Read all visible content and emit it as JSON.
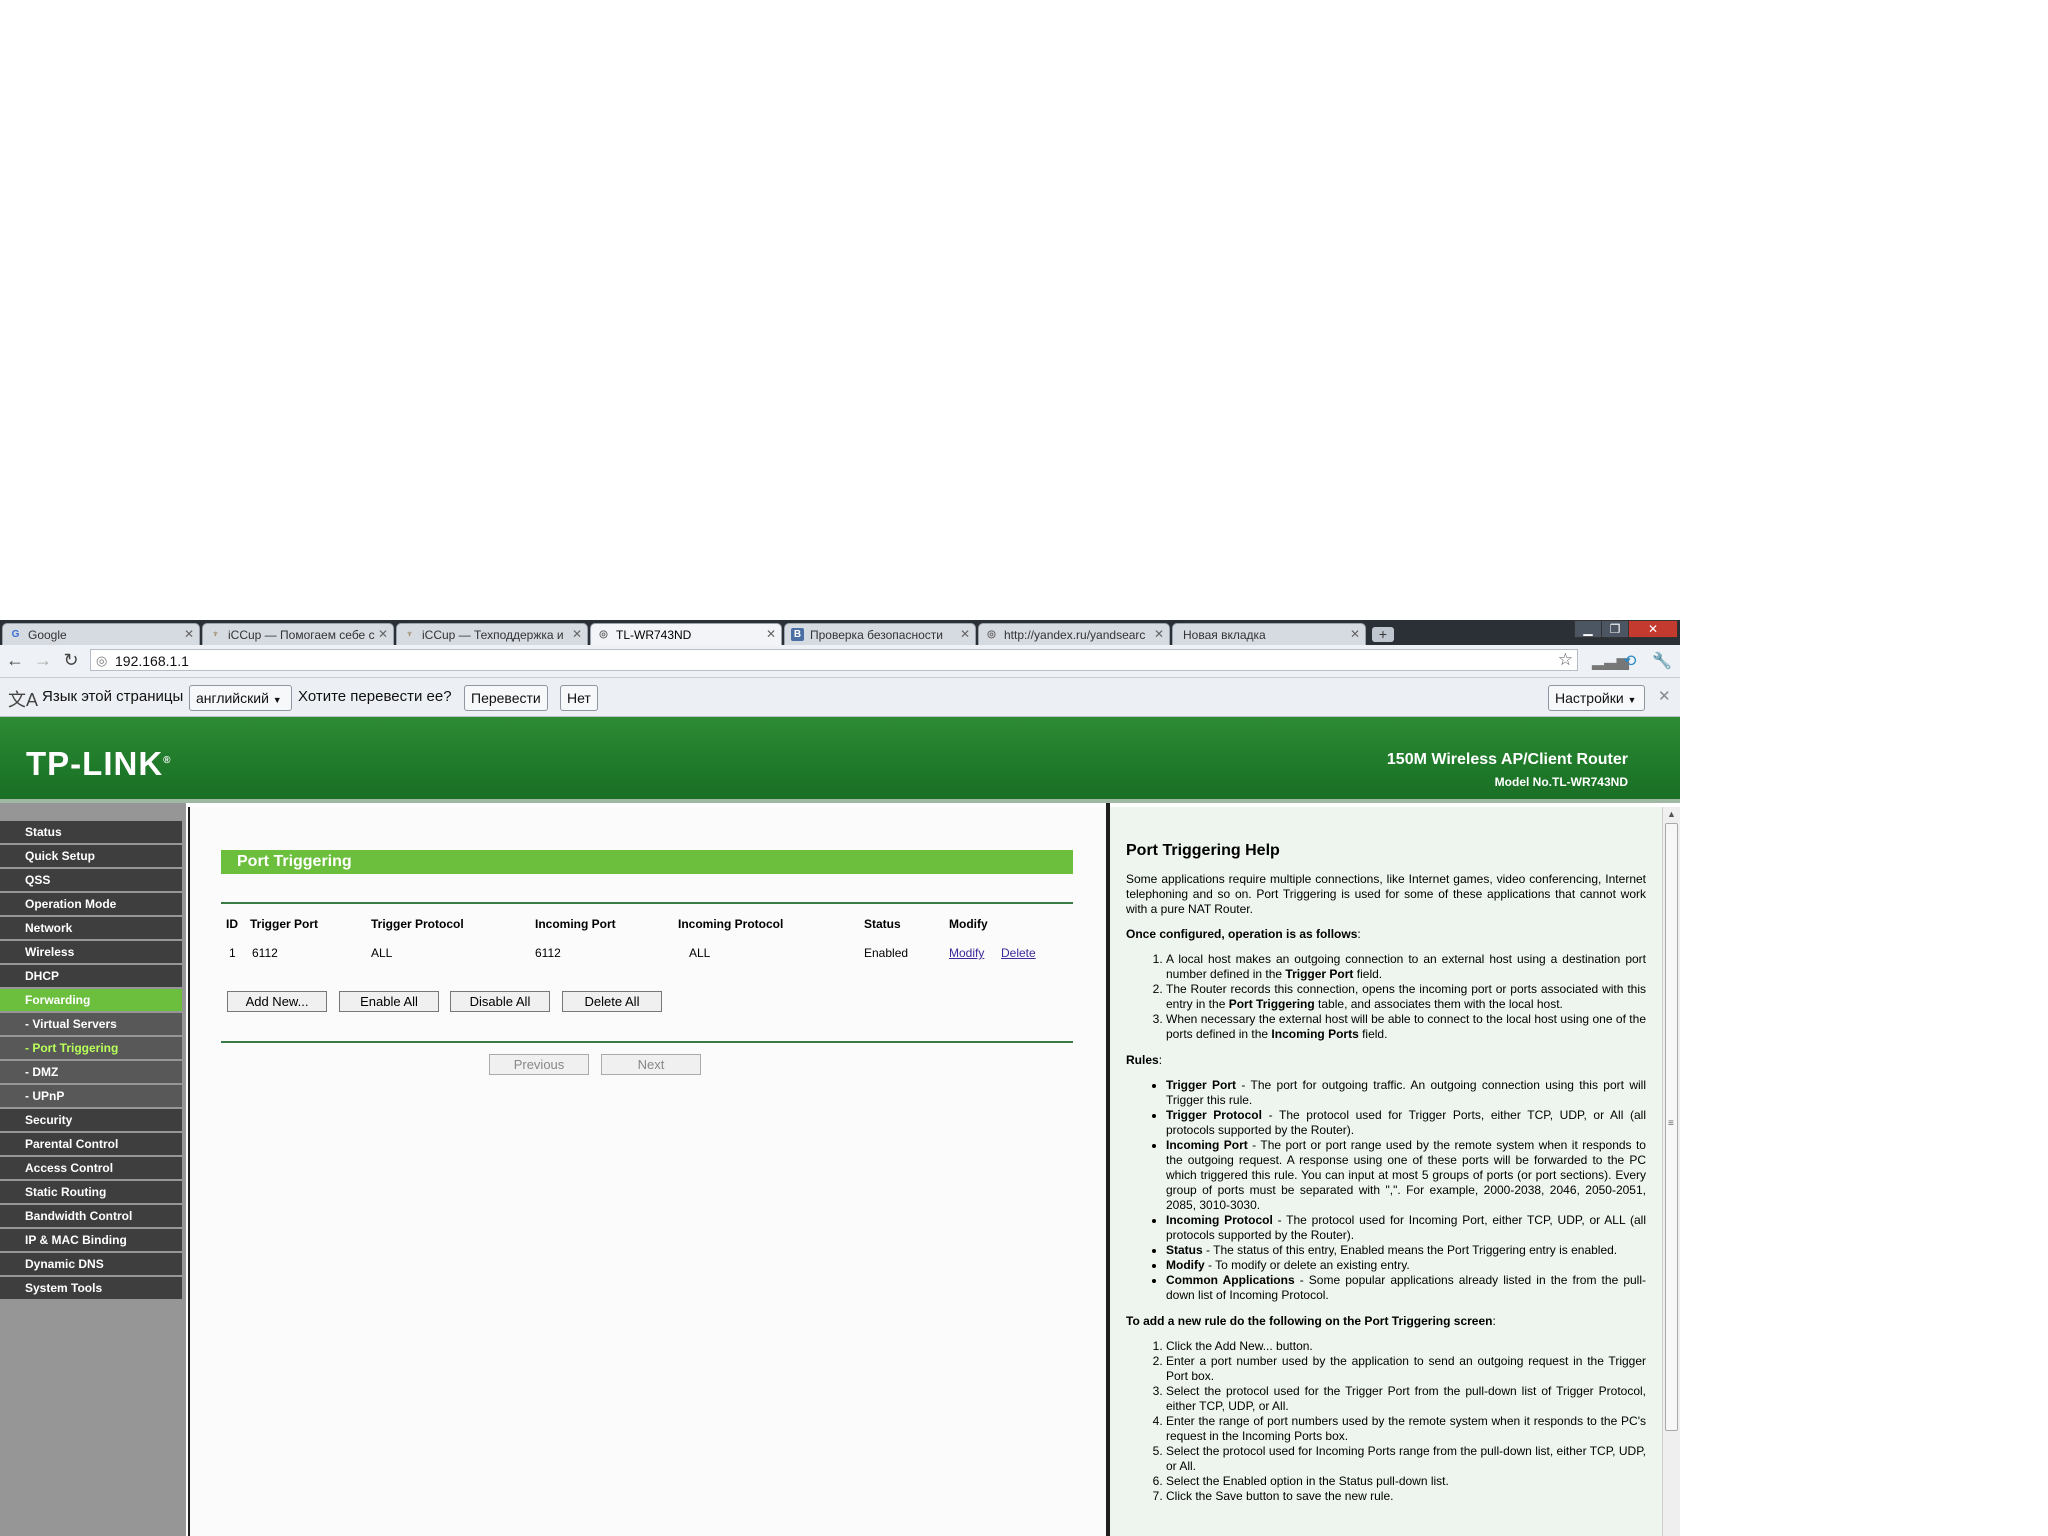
{
  "browser": {
    "tabs": [
      {
        "label": "Google",
        "favicon": "google-icon"
      },
      {
        "label": "iCCup — Помогаем себе с",
        "favicon": "iccup-icon"
      },
      {
        "label": "iCCup — Техподдержка и",
        "favicon": "iccup-icon"
      },
      {
        "label": "TL-WR743ND",
        "favicon": "globe-icon",
        "active": true
      },
      {
        "label": "Проверка безопасности",
        "favicon": "vk-icon"
      },
      {
        "label": "http://yandex.ru/yandsearc",
        "favicon": "globe-icon"
      },
      {
        "label": "Новая вкладка",
        "favicon": ""
      }
    ],
    "url": "192.168.1.1",
    "new_tab_symbol": "+"
  },
  "translate_bar": {
    "prefix": "Язык этой страницы",
    "language": "английский",
    "question": "Хотите перевести ее?",
    "translate_button": "Перевести",
    "no_button": "Нет",
    "settings_button": "Настройки"
  },
  "router": {
    "logo": "TP-LINK",
    "logo_mark": "®",
    "product": "150M Wireless AP/Client Router",
    "model": "Model No.TL-WR743ND"
  },
  "menu": [
    {
      "label": "Status",
      "type": "item"
    },
    {
      "label": "Quick Setup",
      "type": "item"
    },
    {
      "label": "QSS",
      "type": "item"
    },
    {
      "label": "Operation Mode",
      "type": "item"
    },
    {
      "label": "Network",
      "type": "item"
    },
    {
      "label": "Wireless",
      "type": "item"
    },
    {
      "label": "DHCP",
      "type": "item"
    },
    {
      "label": "Forwarding",
      "type": "active"
    },
    {
      "label": "- Virtual Servers",
      "type": "sub"
    },
    {
      "label": "- Port Triggering",
      "type": "subactive"
    },
    {
      "label": "- DMZ",
      "type": "sub"
    },
    {
      "label": "- UPnP",
      "type": "sub"
    },
    {
      "label": "Security",
      "type": "item"
    },
    {
      "label": "Parental Control",
      "type": "item"
    },
    {
      "label": "Access Control",
      "type": "item"
    },
    {
      "label": "Static Routing",
      "type": "item"
    },
    {
      "label": "Bandwidth Control",
      "type": "item"
    },
    {
      "label": "IP & MAC Binding",
      "type": "item"
    },
    {
      "label": "Dynamic DNS",
      "type": "item"
    },
    {
      "label": "System Tools",
      "type": "item"
    }
  ],
  "main": {
    "title": "Port Triggering",
    "columns": [
      "ID",
      "Trigger Port",
      "Trigger Protocol",
      "Incoming Port",
      "Incoming Protocol",
      "Status",
      "Modify"
    ],
    "row": {
      "id": "1",
      "trigger_port": "6112",
      "trigger_protocol": "ALL",
      "incoming_port": "6112",
      "incoming_protocol": "ALL",
      "status": "Enabled",
      "modify_link": "Modify",
      "delete_link": "Delete"
    },
    "buttons": {
      "add_new": "Add New...",
      "enable_all": "Enable All",
      "disable_all": "Disable All",
      "delete_all": "Delete All",
      "previous": "Previous",
      "next": "Next"
    }
  },
  "help": {
    "title": "Port Triggering Help",
    "intro": "Some applications require multiple connections, like Internet games, video conferencing, Internet telephoning and so on. Port Triggering is used for some of these applications that cannot work with a pure NAT Router.",
    "once_configured": "Once configured, operation is as follows",
    "operation_steps": [
      {
        "pre": "A local host makes an outgoing connection to an external host using a destination port number defined in the ",
        "bold": "Trigger Port",
        "post": " field."
      },
      {
        "pre": "The Router records this connection, opens the incoming port or ports associated with this entry in the ",
        "bold": "Port Triggering",
        "post": " table, and associates them with the local host."
      },
      {
        "pre": "When necessary the external host will be able to connect to the local host using one of the ports defined in the ",
        "bold": "Incoming Ports",
        "post": " field."
      }
    ],
    "rules_label": "Rules",
    "rules": [
      {
        "bold": "Trigger Port",
        "text": " - The port for outgoing traffic. An outgoing connection using this port will Trigger this rule."
      },
      {
        "bold": "Trigger Protocol",
        "text": " - The protocol used for Trigger Ports, either TCP, UDP, or All (all protocols supported by the Router)."
      },
      {
        "bold": "Incoming Port",
        "text": " - The port or port range used by the remote system when it responds to the outgoing request. A response using one of these ports will be forwarded to the PC which triggered this rule. You can input at most 5 groups of ports (or port sections). Every group of ports must be separated with \",\". For example, 2000-2038, 2046, 2050-2051, 2085, 3010-3030."
      },
      {
        "bold": "Incoming Protocol",
        "text": " - The protocol used for Incoming Port, either TCP, UDP, or ALL (all protocols supported by the Router)."
      },
      {
        "bold": "Status",
        "text": " - The status of this entry, Enabled means the Port Triggering entry is enabled."
      },
      {
        "bold": "Modify",
        "text": " - To modify or delete an existing entry."
      },
      {
        "bold": "Common Applications",
        "text": " - Some popular applications already listed in the from the pull-down list of Incoming Protocol."
      }
    ],
    "add_rule_label": "To add a new rule do the following on the Port Triggering screen",
    "add_steps": [
      "Click the Add New... button.",
      "Enter a port number used by the application to send an outgoing request in the Trigger Port box.",
      "Select the protocol used for the Trigger Port from the pull-down list of Trigger Protocol, either TCP, UDP, or All.",
      "Enter the range of port numbers used by the remote system when it responds to the PC's request in the Incoming Ports box.",
      "Select the protocol used for Incoming Ports range from the pull-down list, either TCP, UDP, or All.",
      "Select the Enabled option in the Status pull-down list.",
      "Click the Save button to save the new rule."
    ]
  },
  "colors": {
    "brand_green": "#1f7a2a",
    "menu_active": "#6cbf3c",
    "menu_dark": "#3e3e3e",
    "sub_active_text": "#b8ff5a"
  }
}
